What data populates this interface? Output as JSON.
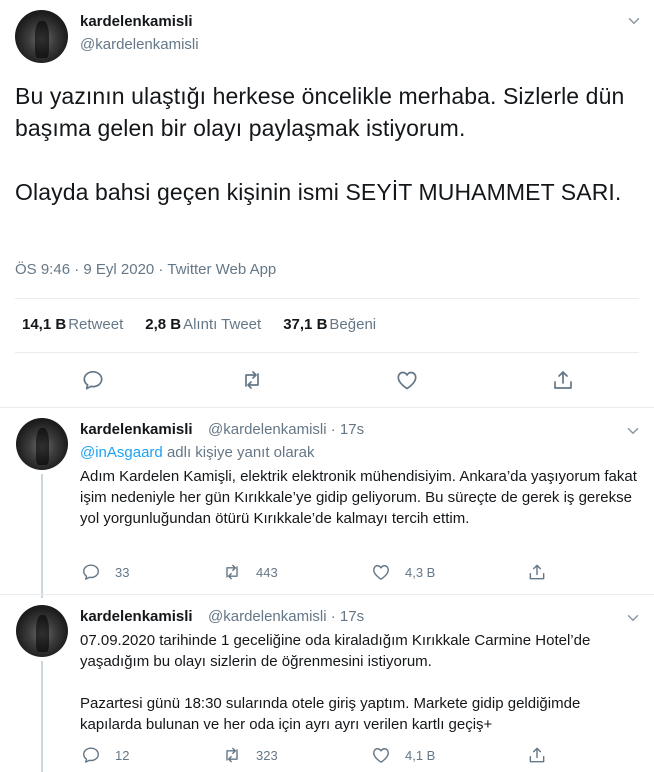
{
  "main_tweet": {
    "display_name": "kardelenkamisli",
    "handle": "@kardelenkamisli",
    "paragraphs": [
      "Bu yazının ulaştığı herkese öncelikle merhaba. Sizlerle dün başıma gelen bir olayı paylaşmak istiyorum.",
      "Olayda bahsi geçen kişinin ismi SEYİT MUHAMMET SARI."
    ],
    "timestamp": "ÖS 9:46 · 9 Eyl 2020 · ",
    "source": "Twitter Web App",
    "stats": [
      {
        "count": "14,1 B",
        "label": "Retweet"
      },
      {
        "count": "2,8 B",
        "label": "Alıntı Tweet"
      },
      {
        "count": "37,1 B",
        "label": "Beğeni"
      }
    ]
  },
  "replies": [
    {
      "display_name": "kardelenkamisli",
      "handle_time": "@kardelenkamisli · 17s",
      "reply_to_user": "@inAsgaard",
      "reply_to_suffix": " adlı kişiye yanıt olarak",
      "paragraphs": [
        "Adım Kardelen Kamişli, elektrik elektronik mühendisiyim. Ankara’da yaşıyorum fakat işim nedeniyle her gün Kırıkkale’ye gidip geliyorum. Bu süreçte de gerek iş gerekse yol yorgunluğundan ötürü Kırıkkale’de kalmayı tercih ettim."
      ],
      "replies_count": "33",
      "retweets_count": "443",
      "likes_count": "4,3 B"
    },
    {
      "display_name": "kardelenkamisli",
      "handle_time": "@kardelenkamisli · 17s",
      "paragraphs": [
        "07.09.2020 tarihinde 1 geceliğine oda kiraladığım Kırıkkale Carmine Hotel’de yaşadığım bu olayı sizlerin de öğrenmesini istiyorum.",
        "Pazartesi günü 18:30 sularında otele giriş yaptım. Markete gidip geldiğimde kapılarda bulunan ve her oda için ayrı ayrı verilen kartlı geçiş+"
      ],
      "replies_count": "12",
      "retweets_count": "323",
      "likes_count": "4,1 B"
    }
  ],
  "icons": {
    "reply": "reply-icon",
    "retweet": "retweet-icon",
    "like": "heart-icon",
    "share": "share-icon",
    "more": "chevron-down-icon"
  },
  "colors": {
    "text": "#14171a",
    "secondary": "#657786",
    "link": "#1da1f2",
    "divider": "#e6ecf0",
    "thread_line": "#ccd6dd"
  }
}
